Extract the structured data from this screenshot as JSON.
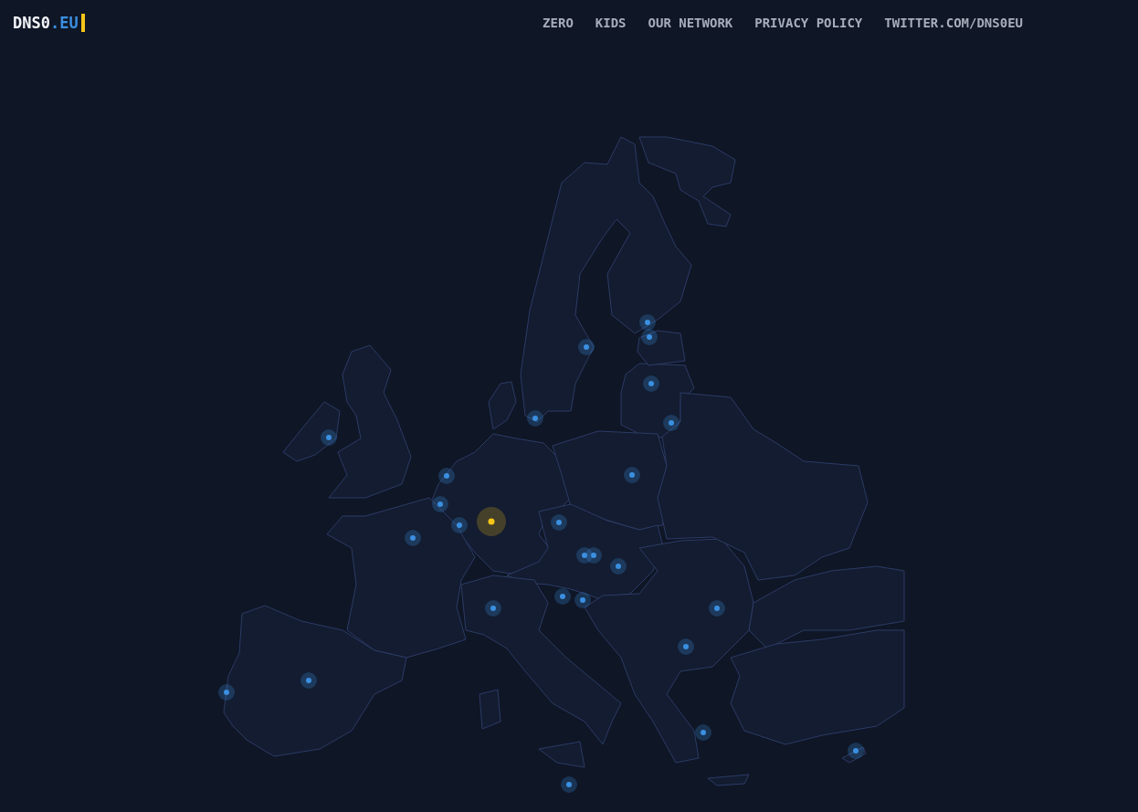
{
  "logo": {
    "name": "DNS0",
    "tld": ".EU"
  },
  "nav": [
    "ZERO",
    "KIDS",
    "OUR NETWORK",
    "PRIVACY POLICY",
    "TWITTER.COM/DNS0EU"
  ],
  "map": {
    "pins": [
      {
        "color": "#3b8fe0"
      },
      {
        "color": "#3b8fe0"
      },
      {
        "color": "#3b8fe0"
      },
      {
        "color": "#3b8fe0"
      },
      {
        "color": "#3b8fe0"
      },
      {
        "color": "#3b8fe0"
      },
      {
        "color": "#3b8fe0"
      },
      {
        "color": "#3b8fe0"
      },
      {
        "color": "#3b8fe0"
      },
      {
        "color": "#3b8fe0"
      },
      {
        "color": "#f5c518"
      },
      {
        "color": "#3b8fe0"
      },
      {
        "color": "#3b8fe0"
      },
      {
        "color": "#3b8fe0"
      },
      {
        "color": "#3b8fe0"
      },
      {
        "color": "#3b8fe0"
      },
      {
        "color": "#3b8fe0"
      },
      {
        "color": "#3b8fe0"
      },
      {
        "color": "#3b8fe0"
      },
      {
        "color": "#3b8fe0"
      },
      {
        "color": "#3b8fe0"
      },
      {
        "color": "#3b8fe0"
      },
      {
        "color": "#3b8fe0"
      },
      {
        "color": "#3b8fe0"
      },
      {
        "color": "#3b8fe0"
      },
      {
        "color": "#3b8fe0"
      },
      {
        "color": "#3b8fe0"
      }
    ]
  }
}
